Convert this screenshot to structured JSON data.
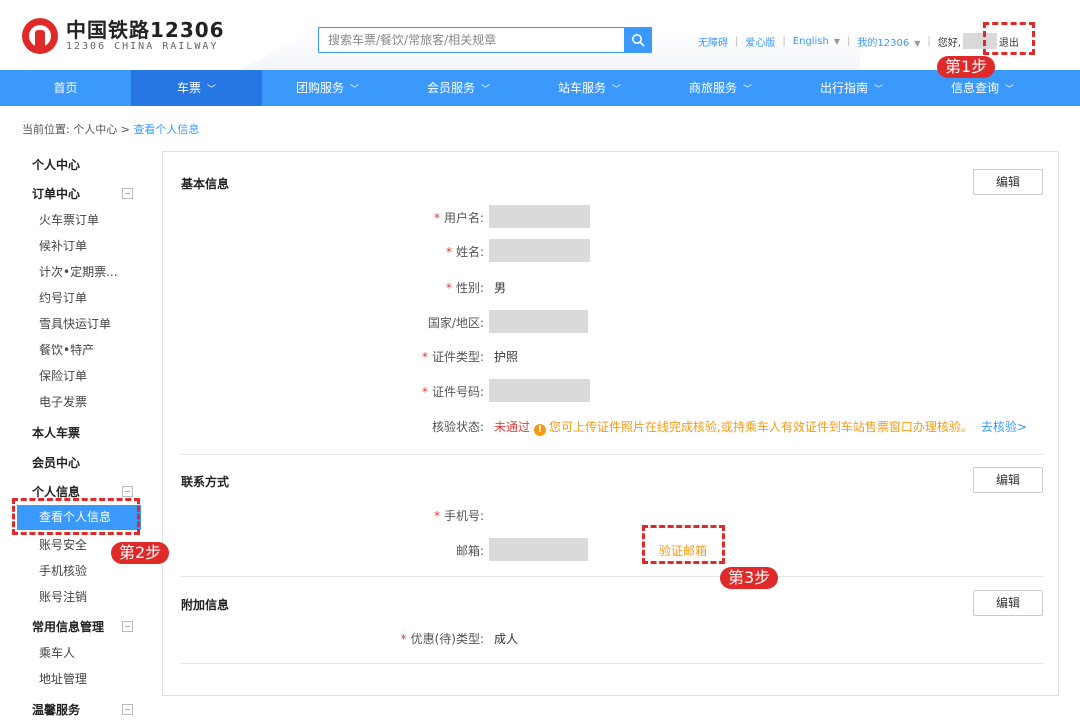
{
  "header": {
    "logo_cn": "中国铁路12306",
    "logo_en": "12306 CHINA RAILWAY",
    "search_placeholder": "搜索车票/餐饮/常旅客/相关规章",
    "links": [
      "无障碍",
      "爱心版",
      "English",
      "我的12306"
    ],
    "greeting": "您好,",
    "logout": "退出"
  },
  "nav": {
    "items": [
      {
        "label": "首页",
        "has_dropdown": false,
        "active": false
      },
      {
        "label": "车票",
        "has_dropdown": true,
        "active": true
      },
      {
        "label": "团购服务",
        "has_dropdown": true,
        "active": false
      },
      {
        "label": "会员服务",
        "has_dropdown": true,
        "active": false
      },
      {
        "label": "站车服务",
        "has_dropdown": true,
        "active": false
      },
      {
        "label": "商旅服务",
        "has_dropdown": true,
        "active": false
      },
      {
        "label": "出行指南",
        "has_dropdown": true,
        "active": false
      },
      {
        "label": "信息查询",
        "has_dropdown": true,
        "active": false
      }
    ]
  },
  "breadcrumb": {
    "prefix": "当前位置:",
    "parent": "个人中心",
    "separator": ">",
    "current": "查看个人信息"
  },
  "sidebar": {
    "personal_center": "个人中心",
    "order_center": "订单中心",
    "orders": [
      "火车票订单",
      "候补订单",
      "计次•定期票...",
      "约号订单",
      "雪具快运订单",
      "餐饮•特产",
      "保险订单",
      "电子发票"
    ],
    "my_tickets": "本人车票",
    "member_center": "会员中心",
    "personal_info": "个人信息",
    "view_info": "查看个人信息",
    "info_items": [
      "账号安全",
      "手机核验",
      "账号注销"
    ],
    "common_info": "常用信息管理",
    "common_items": [
      "乘车人",
      "地址管理"
    ],
    "warm_service": "温馨服务",
    "toggle_symbol": "−"
  },
  "basic_info": {
    "title": "基本信息",
    "edit_label": "编辑",
    "username_label": "用户名:",
    "name_label": "姓名:",
    "gender_label": "性别:",
    "gender_value": "男",
    "country_label": "国家/地区:",
    "id_type_label": "证件类型:",
    "id_type_value": "护照",
    "id_number_label": "证件号码:",
    "verify_label": "核验状态:",
    "verify_status": "未通过",
    "verify_icon": "!",
    "verify_message": "您可上传证件照片在线完成核验,或持乘车人有效证件到车站售票窗口办理核验。",
    "verify_link": "去核验>",
    "required_mark": "*"
  },
  "contact": {
    "title": "联系方式",
    "edit_label": "编辑",
    "phone_label": "手机号:",
    "email_label": "邮箱:",
    "email_verify": "验证邮箱"
  },
  "additional": {
    "title": "附加信息",
    "edit_label": "编辑",
    "discount_label": "优惠(待)类型:",
    "discount_value": "成人"
  },
  "annotations": {
    "step1": "第1步",
    "step2": "第2步",
    "step3": "第3步"
  },
  "colors": {
    "brand_blue": "#3b99fc",
    "nav_active": "#2676e3",
    "logo_red": "#e02a2a",
    "warn_orange": "#f39c12"
  }
}
